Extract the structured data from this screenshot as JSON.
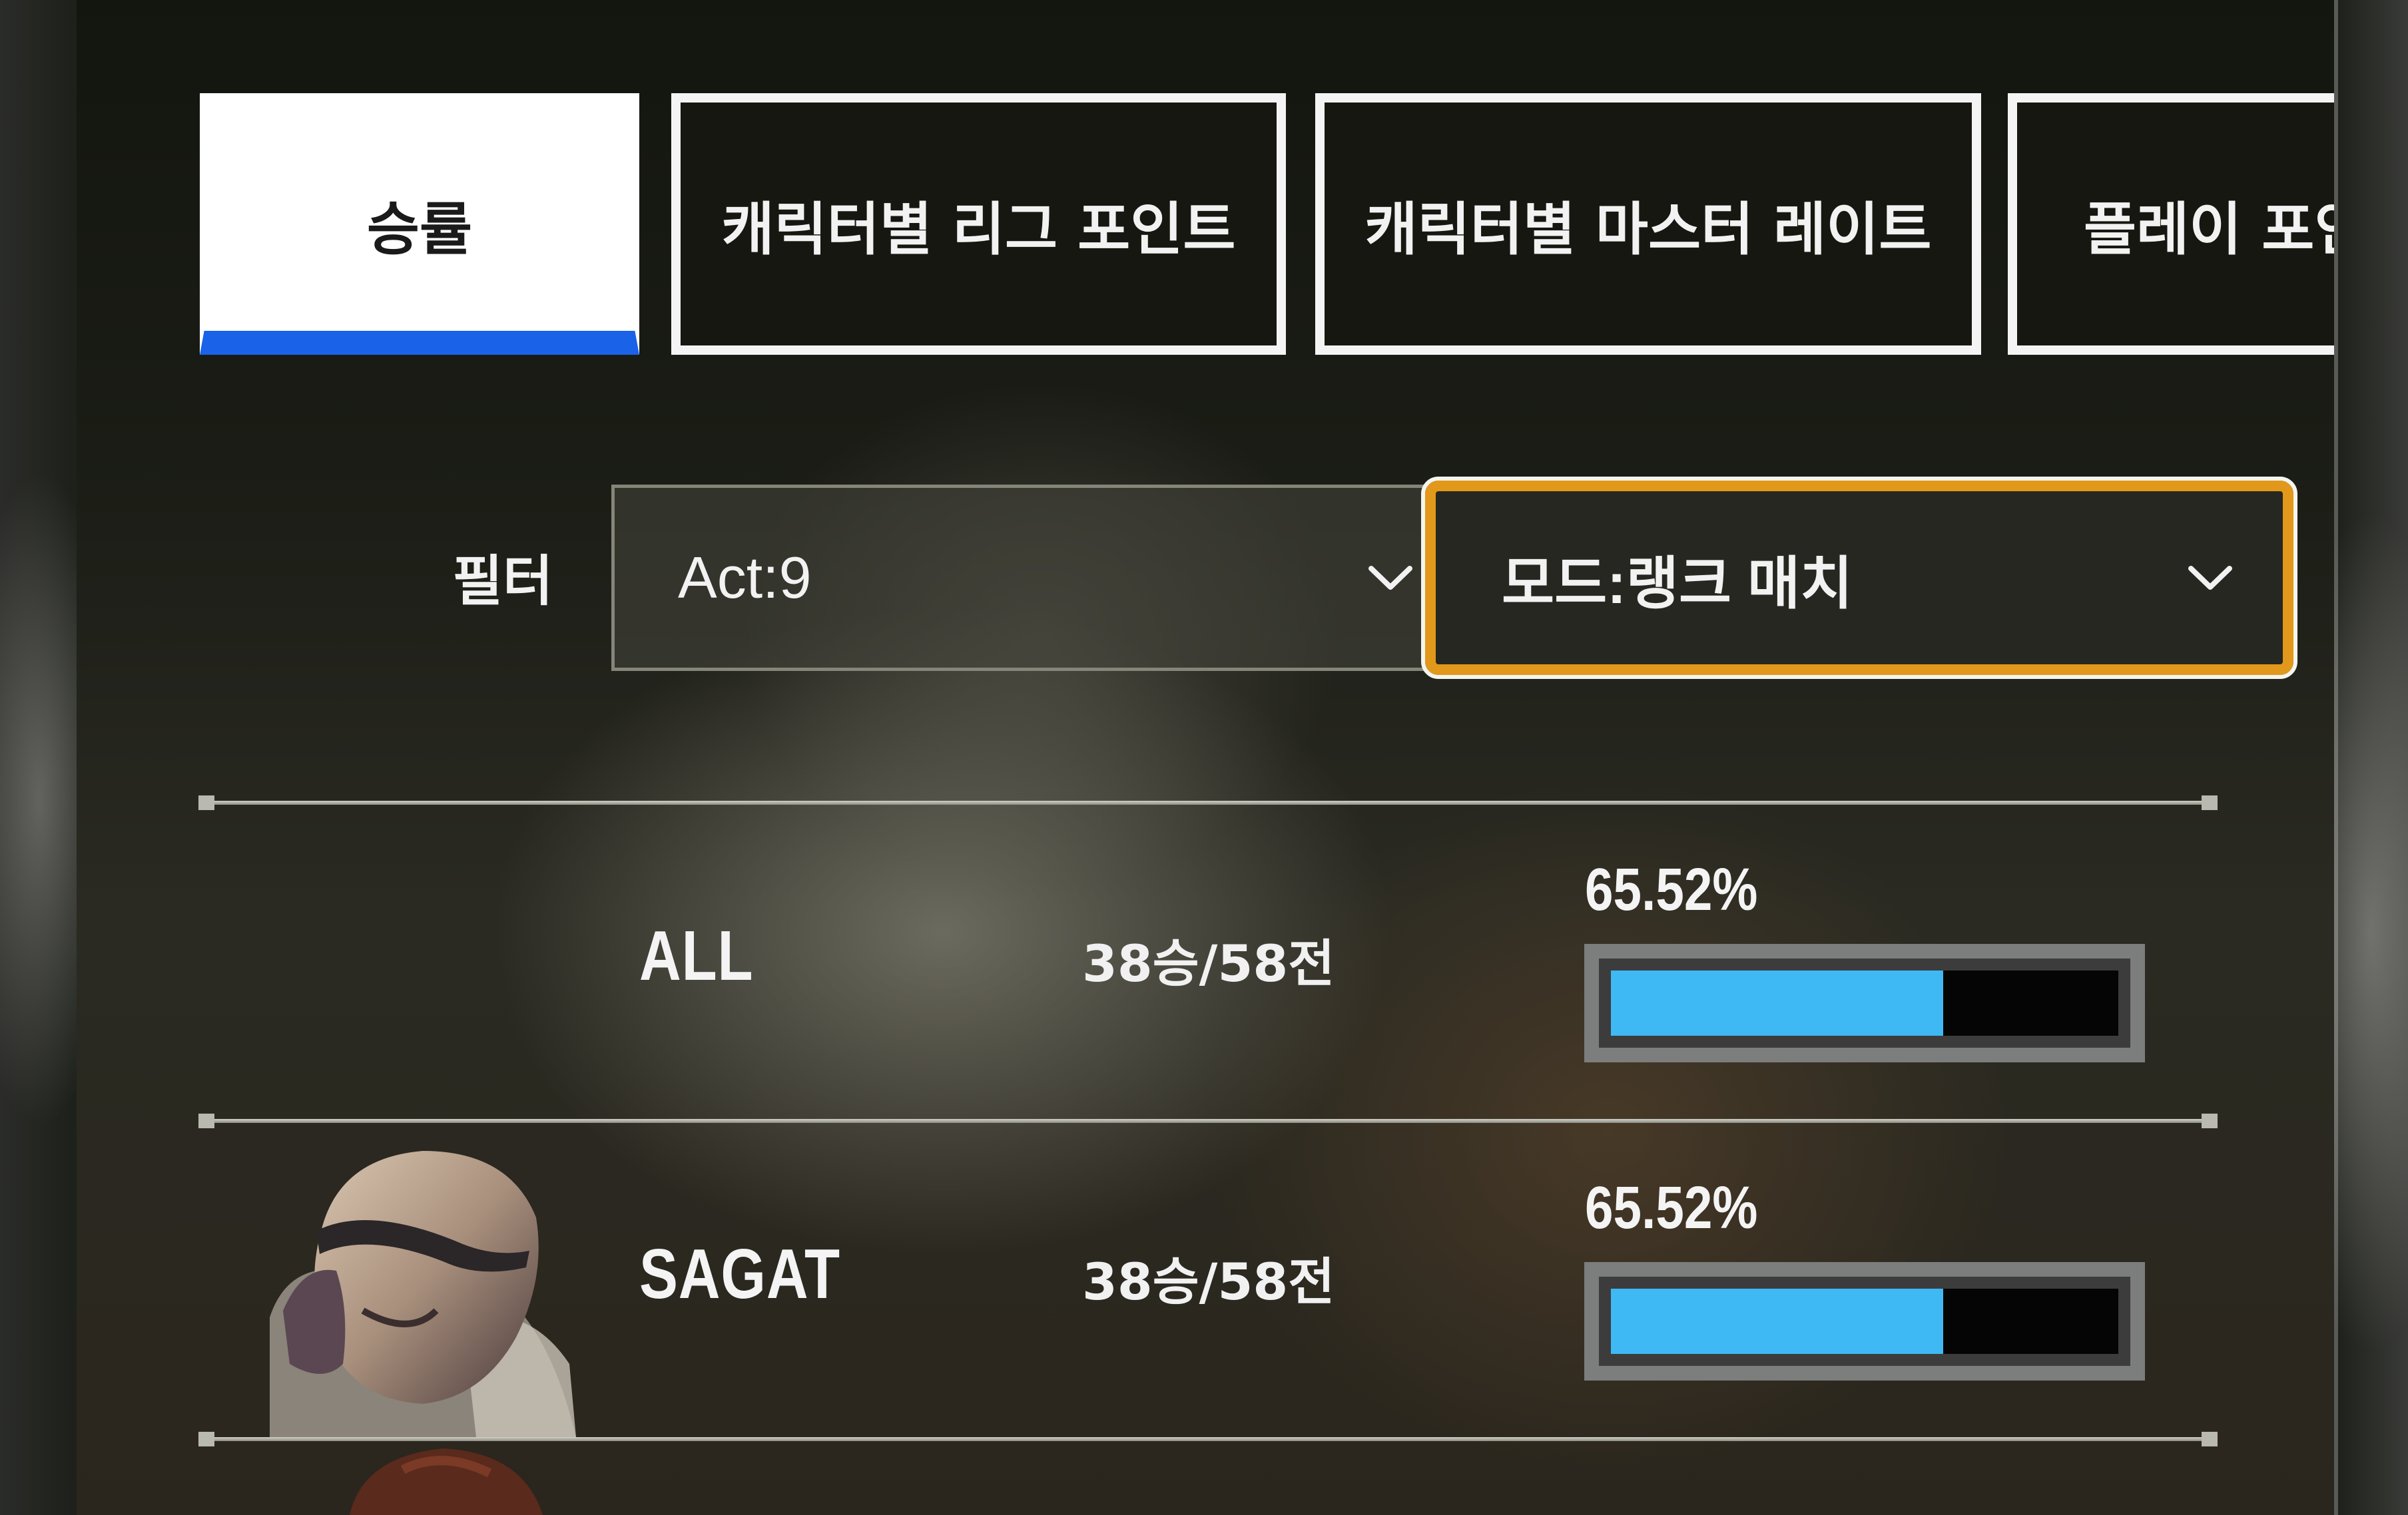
{
  "tabs": [
    {
      "label": "승률",
      "active": true
    },
    {
      "label": "캐릭터별 리그 포인트",
      "active": false
    },
    {
      "label": "캐릭터별 마스터 레이트",
      "active": false
    },
    {
      "label": "플레이 포인",
      "active": false
    }
  ],
  "filter": {
    "label": "필터",
    "act_select": {
      "value": "Act:9",
      "icon": "chevron-down-icon"
    },
    "mode_select": {
      "value": "모드:랭크 매치",
      "icon": "chevron-down-icon",
      "focused": true
    }
  },
  "rows": [
    {
      "character": "ALL",
      "record": "38승/58전",
      "win_rate_label": "65.52%",
      "win_rate": 0.6552,
      "portrait": null
    },
    {
      "character": "SAGAT",
      "record": "38승/58전",
      "win_rate_label": "65.52%",
      "win_rate": 0.6552,
      "portrait": "sagat-portrait"
    }
  ],
  "colors": {
    "accent_blue": "#1a62e8",
    "bar_fill": "#3fb9f4",
    "focus_orange": "#e2981a",
    "side_stripe": "#f08b34"
  }
}
